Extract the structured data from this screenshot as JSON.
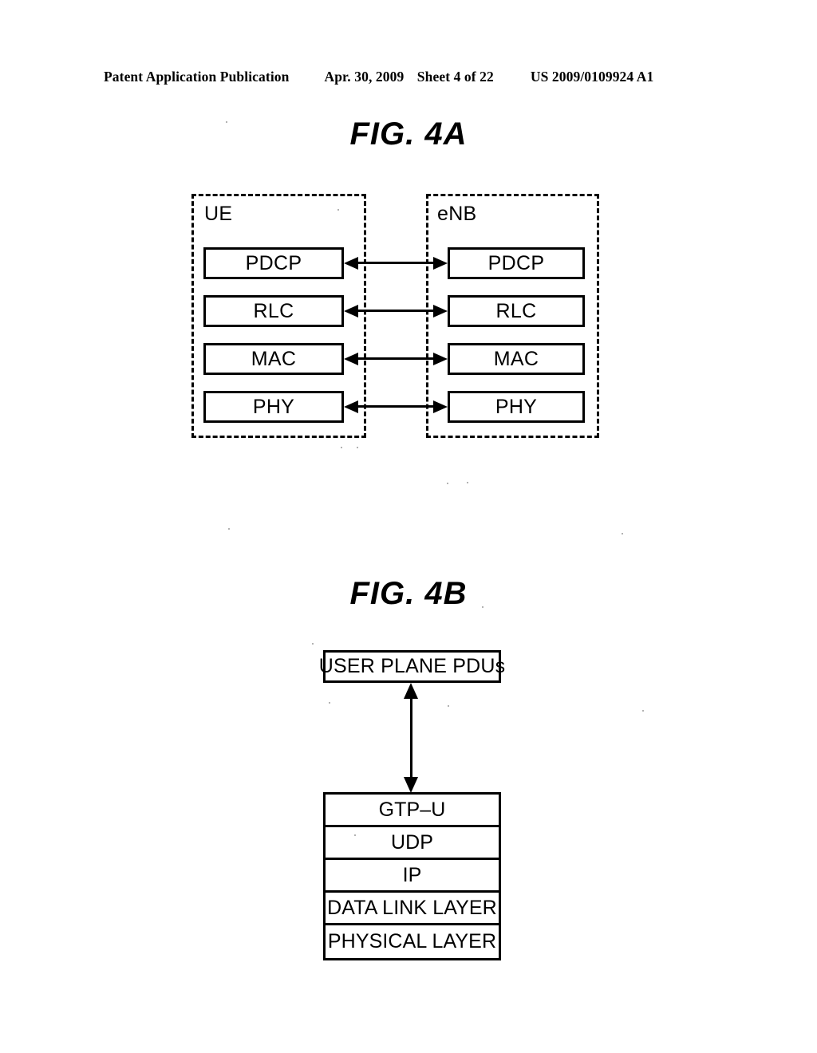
{
  "header": {
    "left": "Patent Application Publication",
    "date": "Apr. 30, 2009",
    "sheet": "Sheet 4 of 22",
    "patent_number": "US 2009/0109924 A1"
  },
  "figures": [
    {
      "id": "fig-4a",
      "title": "FIG. 4A",
      "type": "protocol-stack-peer-diagram",
      "groups": [
        {
          "name": "UE",
          "label": "UE",
          "border": "dashed",
          "layers": [
            "PDCP",
            "RLC",
            "MAC",
            "PHY"
          ]
        },
        {
          "name": "eNB",
          "label": "eNB",
          "border": "dashed",
          "layers": [
            "PDCP",
            "RLC",
            "MAC",
            "PHY"
          ]
        }
      ],
      "connections": [
        {
          "from": "UE.PDCP",
          "to": "eNB.PDCP",
          "style": "double-headed-arrow"
        },
        {
          "from": "UE.RLC",
          "to": "eNB.RLC",
          "style": "double-headed-arrow"
        },
        {
          "from": "UE.MAC",
          "to": "eNB.MAC",
          "style": "double-headed-arrow"
        },
        {
          "from": "UE.PHY",
          "to": "eNB.PHY",
          "style": "double-headed-arrow"
        }
      ]
    },
    {
      "id": "fig-4b",
      "title": "FIG. 4B",
      "type": "protocol-stack-diagram",
      "top_box": "USER PLANE PDUs",
      "connector": "double-headed-arrow",
      "stack": [
        "GTP–U",
        "UDP",
        "IP",
        "DATA LINK LAYER",
        "PHYSICAL LAYER"
      ]
    }
  ],
  "colors": {
    "ink": "#000000",
    "paper": "#ffffff"
  }
}
